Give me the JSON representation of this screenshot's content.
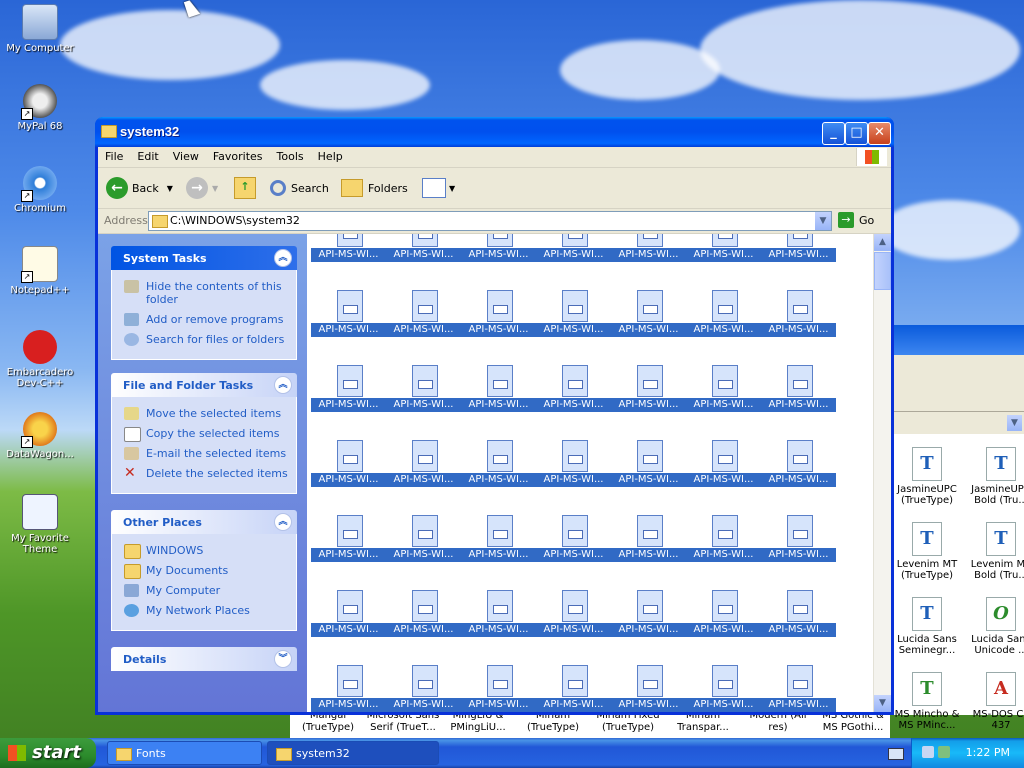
{
  "desktop": {
    "icons": [
      {
        "label": "My Computer"
      },
      {
        "label": "MyPal 68"
      },
      {
        "label": "Chromium"
      },
      {
        "label": "Notepad++"
      },
      {
        "label": "Embarcadero Dev-C++"
      },
      {
        "label": "DataWagon..."
      },
      {
        "label": "My Favorite Theme"
      }
    ]
  },
  "fonts_window": {
    "items": [
      {
        "label": "JasmineUPC (TrueType)",
        "glyph": "T"
      },
      {
        "label": "JasmineUPC Bold (Tru...",
        "glyph": "T"
      },
      {
        "label": "Levenim MT (TrueType)",
        "glyph": "T"
      },
      {
        "label": "Levenim MT Bold (Tru...",
        "glyph": "T"
      },
      {
        "label": "Lucida Sans Seminegr...",
        "glyph": "T"
      },
      {
        "label": "Lucida Sans Unicode ...",
        "glyph": "O"
      },
      {
        "label": "MS Mincho & MS PMinc...",
        "glyph": "T"
      },
      {
        "label": "MS-DOS CP 437",
        "glyph": "A"
      }
    ],
    "bottom_row": [
      {
        "label": "Mangal (TrueType)"
      },
      {
        "label": "Microsoft Sans Serif (TrueT..."
      },
      {
        "label": "MingLiU & PMingLiU..."
      },
      {
        "label": "Miriam (TrueType)"
      },
      {
        "label": "Miriam Fixed (TrueType)"
      },
      {
        "label": "Miriam Transpar..."
      },
      {
        "label": "Modern (All res)"
      },
      {
        "label": "MS Gothic & MS PGothi..."
      }
    ]
  },
  "window": {
    "title": "system32",
    "menu": [
      "File",
      "Edit",
      "View",
      "Favorites",
      "Tools",
      "Help"
    ],
    "toolbar": {
      "back": "Back",
      "search": "Search",
      "folders": "Folders"
    },
    "address": {
      "label": "Address",
      "value": "C:\\WINDOWS\\system32",
      "go": "Go"
    },
    "task_pane": {
      "system_tasks": {
        "title": "System Tasks",
        "links": [
          "Hide the contents of this folder",
          "Add or remove programs",
          "Search for files or folders"
        ]
      },
      "file_folder_tasks": {
        "title": "File and Folder Tasks",
        "links": [
          "Move the selected items",
          "Copy the selected items",
          "E-mail the selected items",
          "Delete the selected items"
        ]
      },
      "other_places": {
        "title": "Other Places",
        "links": [
          "WINDOWS",
          "My Documents",
          "My Computer",
          "My Network Places"
        ]
      },
      "details": {
        "title": "Details"
      }
    },
    "file_label": "API-MS-WI..."
  },
  "taskbar": {
    "start": "start",
    "tasks": [
      {
        "label": "Fonts",
        "active": false
      },
      {
        "label": "system32",
        "active": true
      }
    ],
    "clock": "1:22 PM"
  }
}
